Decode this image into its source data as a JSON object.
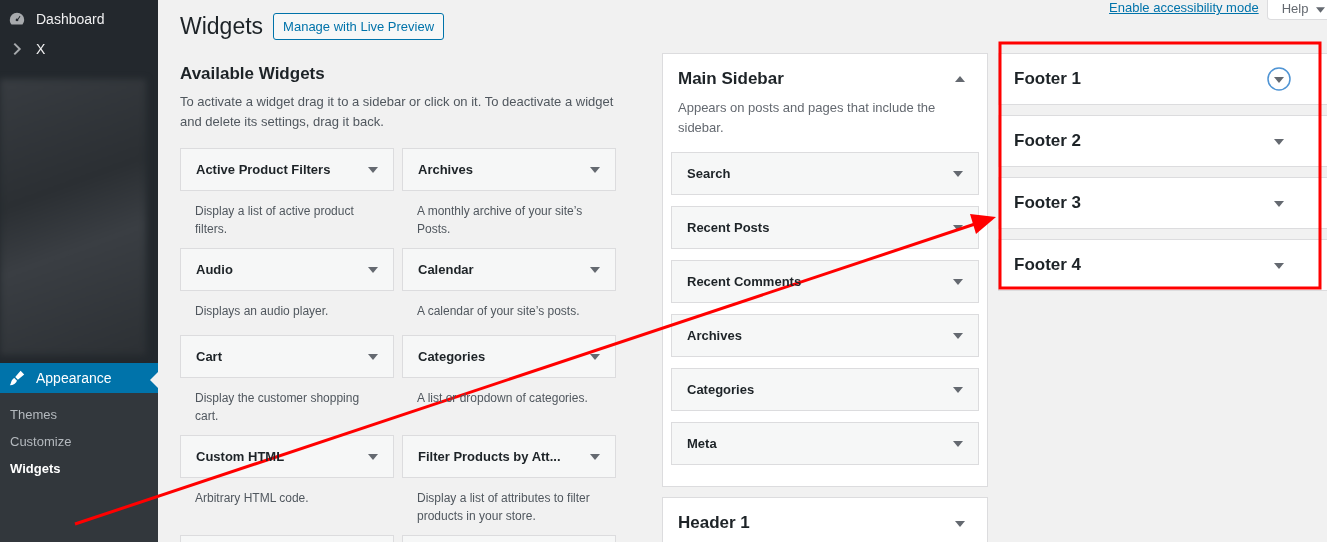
{
  "admin_menu": {
    "items": [
      {
        "label": "Dashboard",
        "selected": false
      },
      {
        "label": "X",
        "selected": false
      },
      {
        "label": "Appearance",
        "selected": true
      }
    ],
    "submenu": [
      {
        "label": "Themes",
        "selected": false
      },
      {
        "label": "Customize",
        "selected": false
      },
      {
        "label": "Widgets",
        "selected": true
      }
    ]
  },
  "screen_links": {
    "accessibility": "Enable accessibility mode",
    "help": "Help"
  },
  "page": {
    "title": "Widgets",
    "action": "Manage with Live Preview"
  },
  "available": {
    "title": "Available Widgets",
    "description": "To activate a widget drag it to a sidebar or click on it. To deactivate a widget and delete its settings, drag it back.",
    "widgets": [
      {
        "name": "Active Product Filters",
        "description": "Display a list of active product filters."
      },
      {
        "name": "Archives",
        "description": "A monthly archive of your site’s Posts."
      },
      {
        "name": "Audio",
        "description": "Displays an audio player."
      },
      {
        "name": "Calendar",
        "description": "A calendar of your site’s posts."
      },
      {
        "name": "Cart",
        "description": "Display the customer shopping cart."
      },
      {
        "name": "Categories",
        "description": "A list or dropdown of categories."
      },
      {
        "name": "Custom HTML",
        "description": "Arbitrary HTML code."
      },
      {
        "name": "Filter Products by Att...",
        "description": "Display a list of attributes to filter products in your store."
      }
    ]
  },
  "middle_areas": [
    {
      "name": "Main Sidebar",
      "expanded": true,
      "focused": false,
      "description": "Appears on posts and pages that include the sidebar.",
      "widgets": [
        "Search",
        "Recent Posts",
        "Recent Comments",
        "Archives",
        "Categories",
        "Meta"
      ]
    },
    {
      "name": "Header 1",
      "expanded": false,
      "focused": false
    }
  ],
  "right_areas": [
    {
      "name": "Footer 1",
      "expanded": false,
      "focused": true
    },
    {
      "name": "Footer 2",
      "expanded": false,
      "focused": false
    },
    {
      "name": "Footer 3",
      "expanded": false,
      "focused": false
    },
    {
      "name": "Footer 4",
      "expanded": false,
      "focused": false
    }
  ]
}
